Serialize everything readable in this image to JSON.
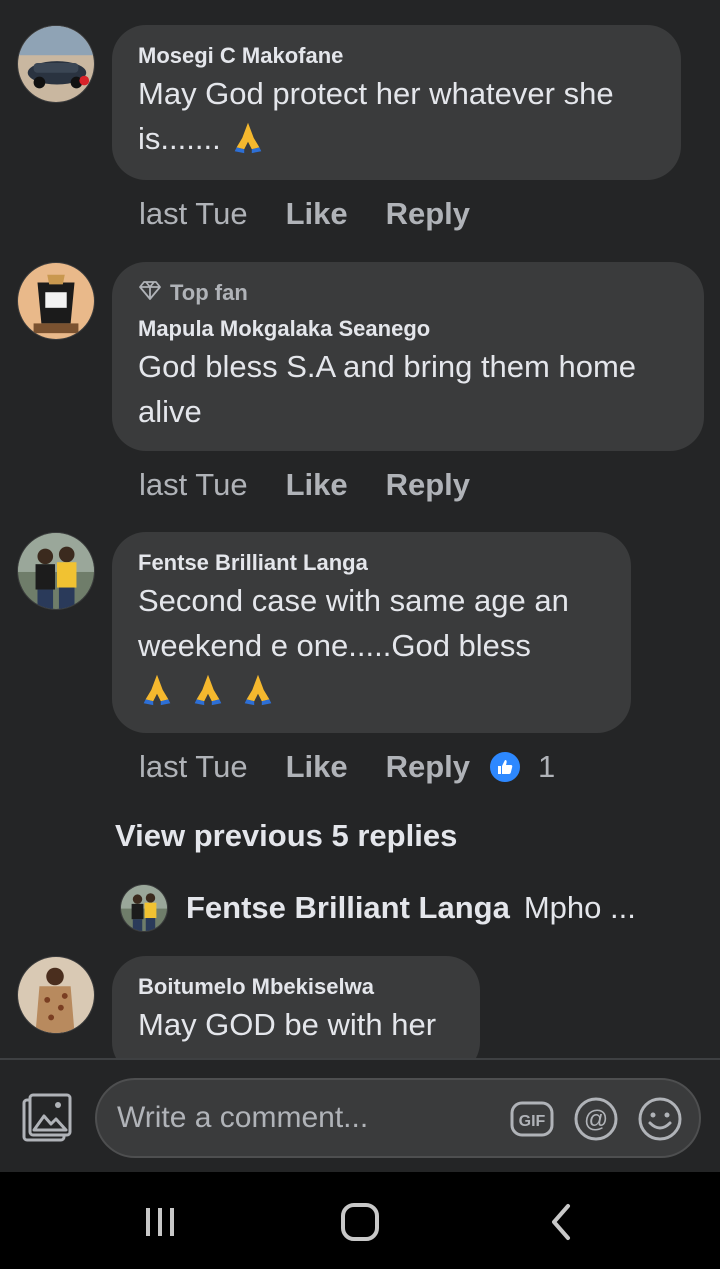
{
  "comments": [
    {
      "author": "Mosegi C Makofane",
      "text": "May God protect her whatever she is.......",
      "time": "last Tue",
      "like_label": "Like",
      "reply_label": "Reply"
    },
    {
      "badge": "Top fan",
      "author": "Mapula Mokgalaka Seanego",
      "text_line1": "God bless S.A and bring them home",
      "text_line2": "alive",
      "time": "last Tue",
      "like_label": "Like",
      "reply_label": "Reply"
    },
    {
      "author": "Fentse Brilliant Langa",
      "text_line1": "Second case with same age an",
      "text_line2": "weekend e one.....God bless",
      "time": "last Tue",
      "like_label": "Like",
      "reply_label": "Reply",
      "reaction_count": "1"
    },
    {
      "author": "Boitumelo Mbekiselwa",
      "text": "May GOD be with her"
    }
  ],
  "view_previous": "View previous 5 replies",
  "reply_preview": {
    "author": "Fentse Brilliant Langa",
    "text": "Mpho ..."
  },
  "composer": {
    "placeholder": "Write a comment..."
  },
  "colors": {
    "background": "#242526",
    "bubble": "#3a3b3c",
    "text": "#e4e6eb",
    "secondary": "#b0b3b8",
    "like_blue": "#2d88ff"
  },
  "icons": [
    "photo-icon",
    "gif-icon",
    "mention-icon",
    "emoji-icon",
    "recent-apps-icon",
    "home-icon",
    "back-icon",
    "diamond-icon",
    "thumbs-up-icon",
    "praying-hands-icon"
  ]
}
